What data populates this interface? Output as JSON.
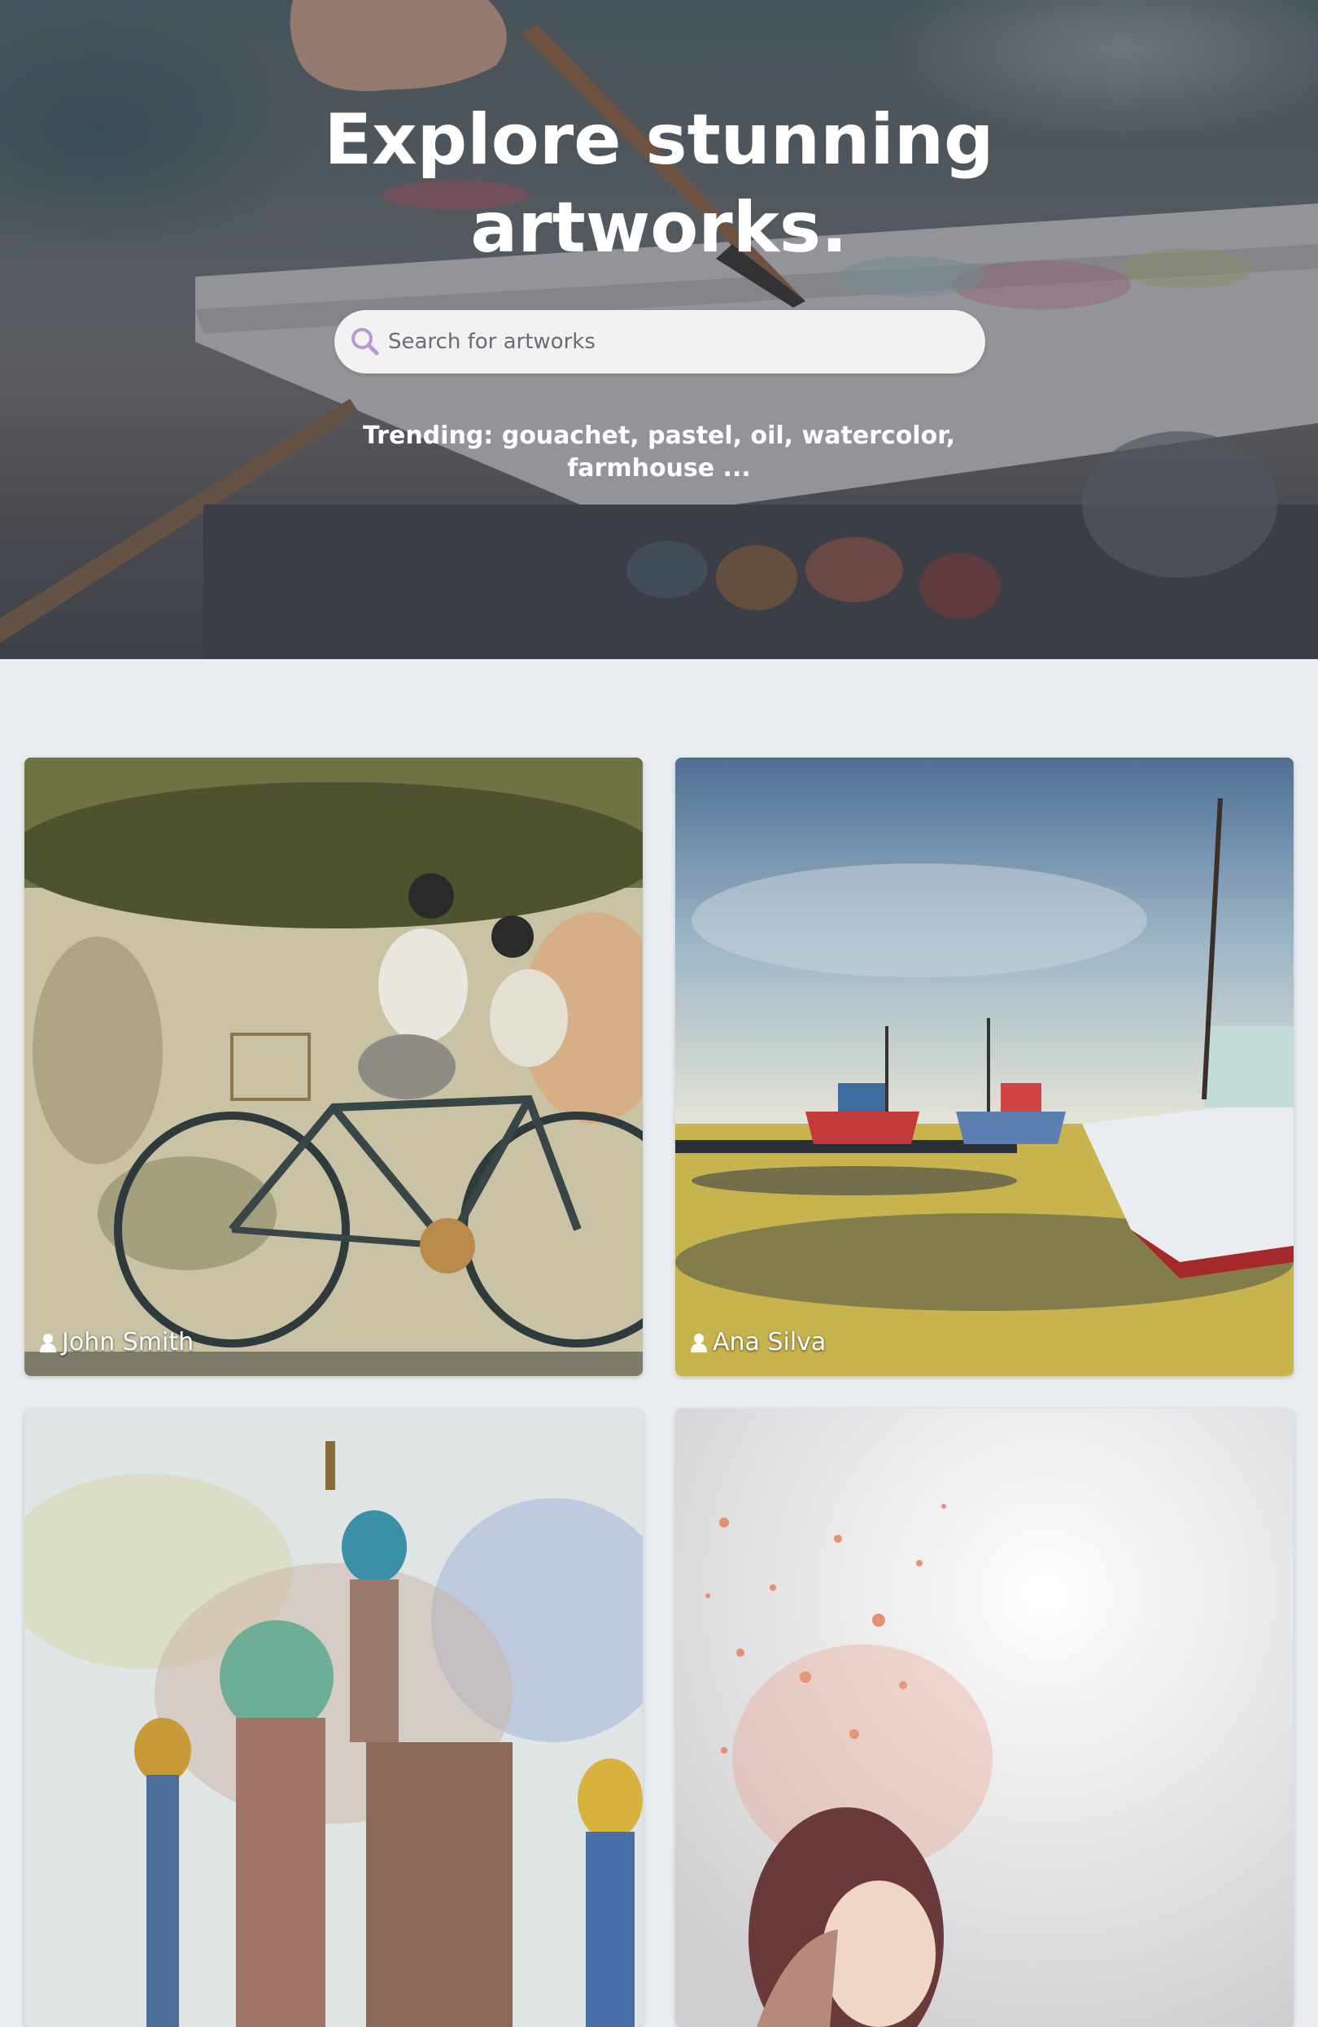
{
  "hero": {
    "title": "Explore stunning artworks.",
    "search": {
      "placeholder": "Search for artworks",
      "icon": "search-icon",
      "icon_color": "#b79ad8"
    },
    "trending_text": "Trending: gouachet, pastel, oil, watercolor, farmhouse ..."
  },
  "gallery": {
    "background": "#e9ecf1",
    "cards": [
      {
        "author": "John Smith",
        "icon": "user-icon"
      },
      {
        "author": "Ana Silva",
        "icon": "user-icon"
      },
      {
        "author": "",
        "icon": "user-icon"
      },
      {
        "author": "",
        "icon": "user-icon"
      }
    ]
  }
}
